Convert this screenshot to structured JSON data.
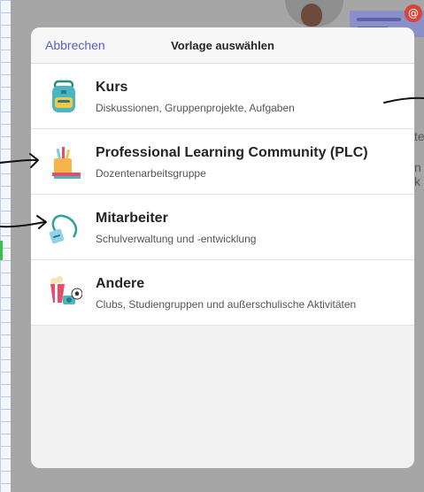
{
  "background": {
    "badge_symbol": "@",
    "text_fragments": [
      "te",
      "n k"
    ]
  },
  "modal": {
    "cancel_label": "Abbrechen",
    "title": "Vorlage auswählen",
    "templates": [
      {
        "name": "Kurs",
        "description": "Diskussionen, Gruppenprojekte, Aufgaben",
        "icon": "backpack-icon"
      },
      {
        "name": "Professional Learning Community (PLC)",
        "description": "Dozentenarbeitsgruppe",
        "icon": "books-pencils-icon"
      },
      {
        "name": "Mitarbeiter",
        "description": "Schulverwaltung und -entwicklung",
        "icon": "lanyard-badge-icon"
      },
      {
        "name": "Andere",
        "description": "Clubs, Studiengruppen und außerschulische Aktivitäten",
        "icon": "popcorn-ball-icon"
      }
    ]
  },
  "colors": {
    "accent": "#5b5fc7",
    "backdrop": "#a6a6a6",
    "badge": "#d8443a"
  }
}
